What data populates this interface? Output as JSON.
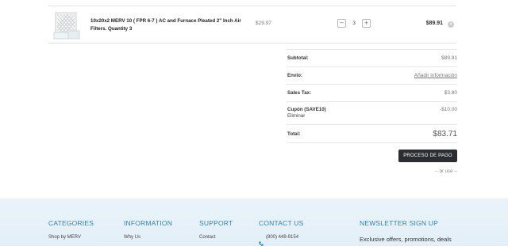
{
  "cart": {
    "item": {
      "name": "10x20x2 MERV 10 ( FPR 6-7 ) AC and Furnace Pleated 2\" Inch Air Filters. Quantity 3",
      "unit_price": "$29.97",
      "quantity": "3",
      "minus_label": "−",
      "plus_label": "+",
      "line_total": "$89.91",
      "remove_label": "×",
      "image_icon": "air-filter-product-image"
    }
  },
  "totals": {
    "subtotal_label": "Subtotal:",
    "subtotal_value": "$89.91",
    "shipping_label": "Envío:",
    "shipping_link": "Añadir información",
    "tax_label": "Sales Tax:",
    "tax_value": "$3.80",
    "coupon_label": "Cupón (SAVE10)",
    "coupon_remove": "Eliminar",
    "coupon_value": "-$10.00",
    "total_label": "Total:",
    "total_value": "$83.71",
    "checkout_button": "PROCESO DE PAGO",
    "or_use": "-- or use --"
  },
  "footer": {
    "categories_heading": "CATEGORIES",
    "categories_link": "Shop by MERV",
    "information_heading": "INFORMATION",
    "information_link": "Why Us",
    "support_heading": "SUPPORT",
    "support_link": "Contact",
    "contact_heading": "CONTACT US",
    "contact_phone": "(800) 449-9154",
    "newsletter_heading": "NEWSLETTER SIGN UP",
    "newsletter_text": "Exclusive offers, promotions, deals"
  },
  "colors": {
    "accent": "#2a86c8",
    "button": "#2b2d30",
    "footer_bg": "#e6f1f9"
  }
}
